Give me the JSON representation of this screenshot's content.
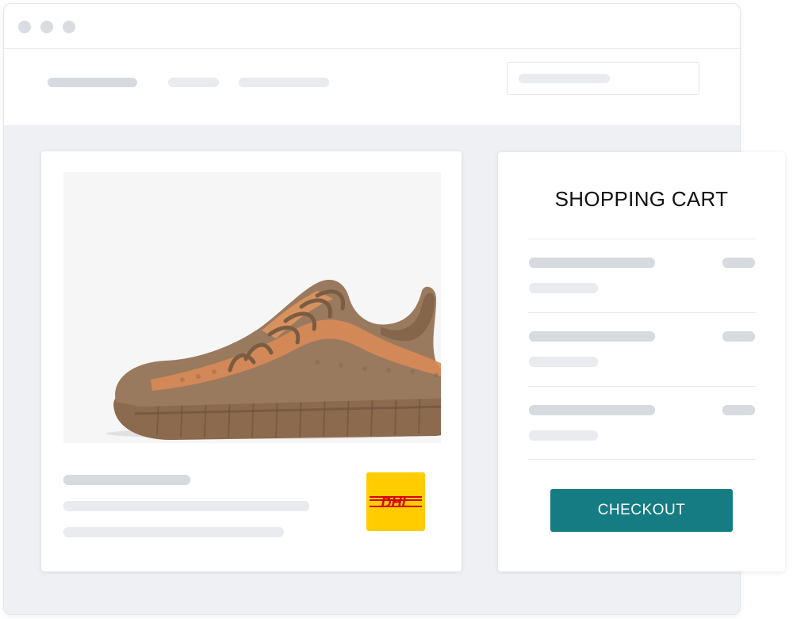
{
  "window": {
    "controls": [
      "window-dot",
      "window-dot",
      "window-dot"
    ]
  },
  "product": {
    "image_alt": "Yeezy Boost 350 V2 Sand Taupe sneaker",
    "badge": "DHL",
    "badge_colors": {
      "background": "#ffcc00",
      "text": "#d40511"
    }
  },
  "cart": {
    "title": "SHOPPING CART",
    "checkout_label": "CHECKOUT",
    "accent_color": "#147c82"
  },
  "colors": {
    "page_bg": "#eef0f4",
    "skeleton_dark": "#d7dadf",
    "skeleton_light": "#e9ebef"
  }
}
